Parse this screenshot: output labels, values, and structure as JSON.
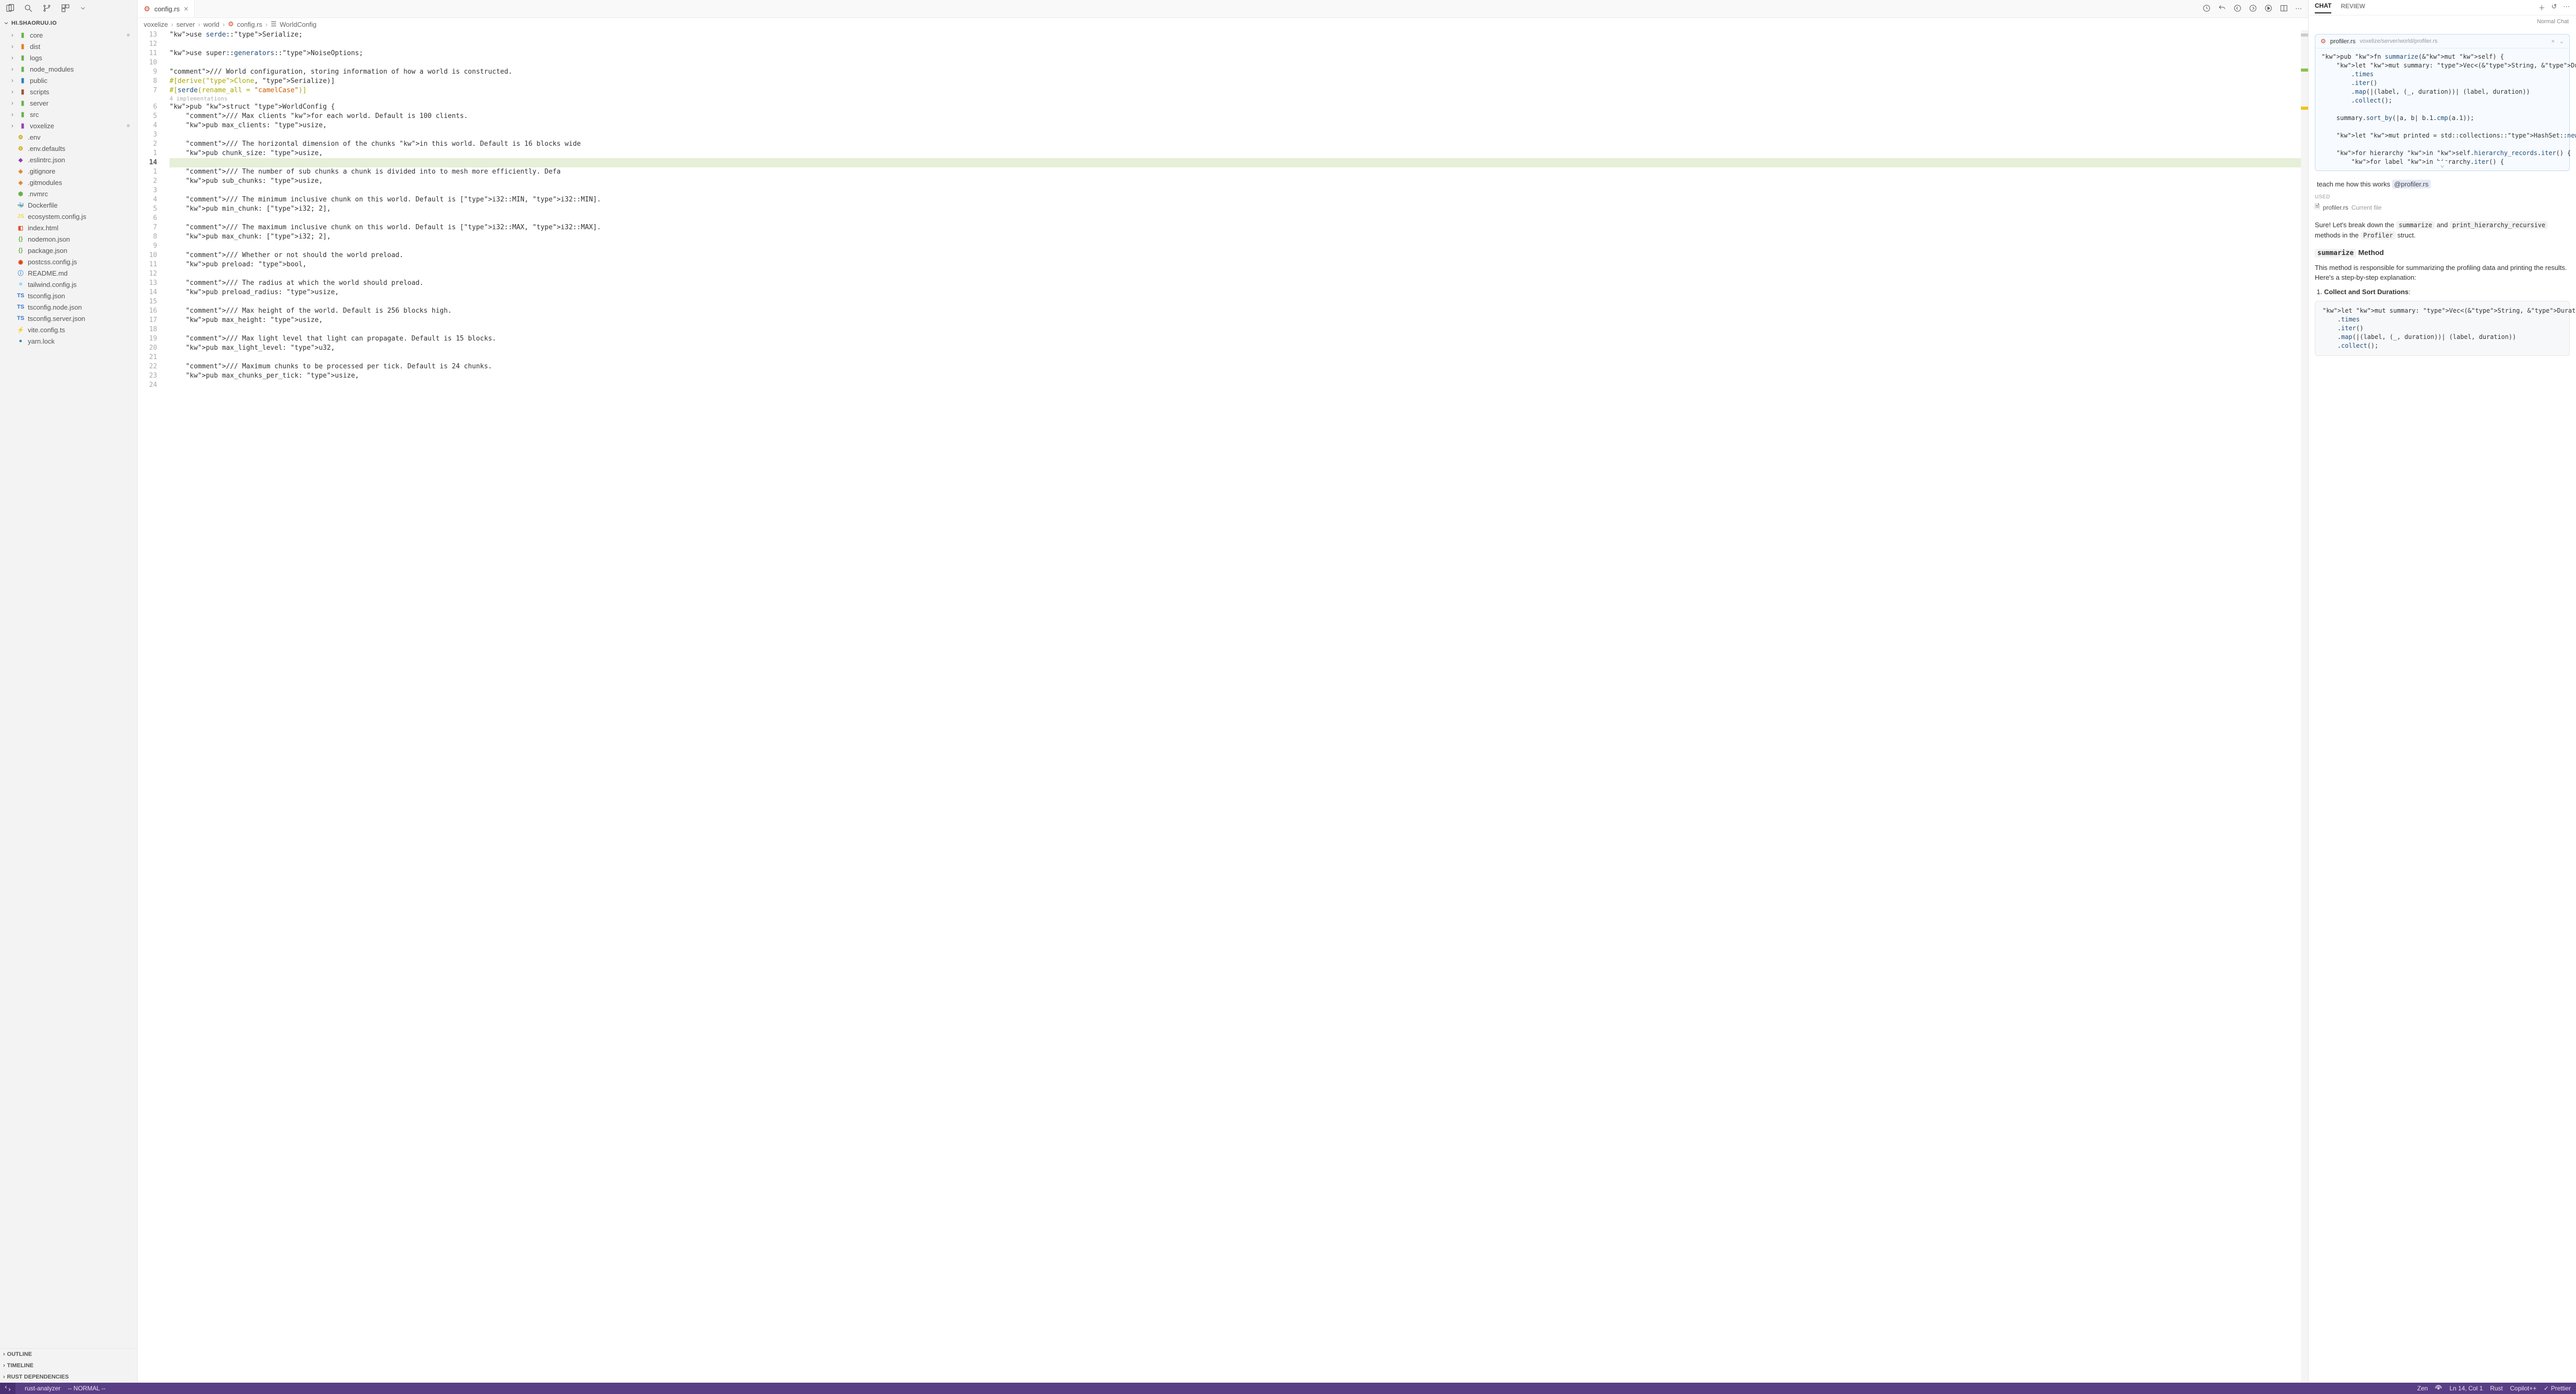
{
  "project": {
    "name": "HI.SHAORUU.IO"
  },
  "sidebar": {
    "folders": [
      {
        "name": "core",
        "color": "folder-green",
        "dot": true
      },
      {
        "name": "dist",
        "color": "folder-orange",
        "dot": false
      },
      {
        "name": "logs",
        "color": "folder-green",
        "dot": false
      },
      {
        "name": "node_modules",
        "color": "folder-green",
        "dot": false
      },
      {
        "name": "public",
        "color": "folder-blue",
        "dot": false
      },
      {
        "name": "scripts",
        "color": "folder-brown",
        "dot": false
      },
      {
        "name": "server",
        "color": "folder-green",
        "dot": false
      },
      {
        "name": "src",
        "color": "folder-green",
        "dot": false
      },
      {
        "name": "voxelize",
        "color": "folder-purple",
        "dot": true
      }
    ],
    "files": [
      {
        "name": ".env",
        "icon": "⚙",
        "iconColor": "#c9a400"
      },
      {
        "name": ".env.defaults",
        "icon": "⚙",
        "iconColor": "#c9a400"
      },
      {
        "name": ".eslintrc.json",
        "icon": "◆",
        "iconColor": "#8e44ad"
      },
      {
        "name": ".gitignore",
        "icon": "◈",
        "iconColor": "#e67e22"
      },
      {
        "name": ".gitmodules",
        "icon": "◈",
        "iconColor": "#e67e22"
      },
      {
        "name": ".nvmrc",
        "icon": "⬢",
        "iconColor": "#6ab04c"
      },
      {
        "name": "Dockerfile",
        "icon": "🐳",
        "iconColor": "#2496ed"
      },
      {
        "name": "ecosystem.config.js",
        "icon": "JS",
        "iconColor": "#f0db4f"
      },
      {
        "name": "index.html",
        "icon": "◧",
        "iconColor": "#e34c26"
      },
      {
        "name": "nodemon.json",
        "icon": "{}",
        "iconColor": "#6ab04c"
      },
      {
        "name": "package.json",
        "icon": "{}",
        "iconColor": "#6ab04c"
      },
      {
        "name": "postcss.config.js",
        "icon": "◉",
        "iconColor": "#dd3a0a"
      },
      {
        "name": "README.md",
        "icon": "ⓘ",
        "iconColor": "#4a90d9"
      },
      {
        "name": "tailwind.config.js",
        "icon": "≈",
        "iconColor": "#38bdf8"
      },
      {
        "name": "tsconfig.json",
        "icon": "TS",
        "iconColor": "#3178c6"
      },
      {
        "name": "tsconfig.node.json",
        "icon": "TS",
        "iconColor": "#3178c6"
      },
      {
        "name": "tsconfig.server.json",
        "icon": "TS",
        "iconColor": "#3178c6"
      },
      {
        "name": "vite.config.ts",
        "icon": "⚡",
        "iconColor": "#ffab00"
      },
      {
        "name": "yarn.lock",
        "icon": "●",
        "iconColor": "#2188b6"
      }
    ],
    "sections": [
      "OUTLINE",
      "TIMELINE",
      "RUST DEPENDENCIES"
    ]
  },
  "tab": {
    "filename": "config.rs"
  },
  "breadcrumb": [
    "voxelize",
    "server",
    "world",
    "config.rs",
    "WorldConfig"
  ],
  "gutter": [
    "13",
    "12",
    "11",
    "10",
    "9",
    "8",
    "7",
    "",
    "6",
    "5",
    "4",
    "3",
    "2",
    "1",
    "14",
    "1",
    "2",
    "3",
    "4",
    "5",
    "6",
    "7",
    "8",
    "9",
    "10",
    "11",
    "12",
    "13",
    "14",
    "15",
    "16",
    "17",
    "18",
    "19",
    "20",
    "21",
    "22",
    "23",
    "24"
  ],
  "code": {
    "l1": "use serde::Serialize;",
    "l2": "",
    "l3": "use super::generators::NoiseOptions;",
    "l4": "",
    "l5": "/// World configuration, storing information of how a world is constructed.",
    "l6": "#[derive(Clone, Serialize)]",
    "l7": "#[serde(rename_all = \"camelCase\")]",
    "codelens": "4 implementations",
    "l8": "pub struct WorldConfig {",
    "l9": "    /// Max clients for each world. Default is 100 clients.",
    "l10": "    pub max_clients: usize,",
    "l11": "",
    "l12": "    /// The horizontal dimension of the chunks in this world. Default is 16 blocks wide",
    "l13": "    pub chunk_size: usize,",
    "l14": "",
    "l15": "    /// The number of sub chunks a chunk is divided into to mesh more efficiently. Defa",
    "l16": "    pub sub_chunks: usize,",
    "l17": "",
    "l18": "    /// The minimum inclusive chunk on this world. Default is [i32::MIN, i32::MIN].",
    "l19": "    pub min_chunk: [i32; 2],",
    "l20": "",
    "l21": "    /// The maximum inclusive chunk on this world. Default is [i32::MAX, i32::MAX].",
    "l22": "    pub max_chunk: [i32; 2],",
    "l23": "",
    "l24": "    /// Whether or not should the world preload.",
    "l25": "    pub preload: bool,",
    "l26": "",
    "l27": "    /// The radius at which the world should preload.",
    "l28": "    pub preload_radius: usize,",
    "l29": "",
    "l30": "    /// Max height of the world. Default is 256 blocks high.",
    "l31": "    pub max_height: usize,",
    "l32": "",
    "l33": "    /// Max light level that light can propagate. Default is 15 blocks.",
    "l34": "    pub max_light_level: u32,",
    "l35": "",
    "l36": "    /// Maximum chunks to be processed per tick. Default is 24 chunks.",
    "l37": "    pub max_chunks_per_tick: usize,",
    "l38": ""
  },
  "chat": {
    "tabs": [
      "CHAT",
      "REVIEW"
    ],
    "mode": "Normal Chat",
    "context": {
      "filename": "profiler.rs",
      "path": "voxelize/server/world/profiler.rs",
      "code": "pub fn summarize(&mut self) {\n    let mut summary: Vec<(&String, &Duration)> = self\n        .times\n        .iter()\n        .map(|(label, (_, duration))| (label, duration))\n        .collect();\n\n    summary.sort_by(|a, b| b.1.cmp(a.1));\n\n    let mut printed = std::collections::HashSet::new();\n\n    for hierarchy in self.hierarchy_records.iter() {\n        for label in hierarchy.iter() {"
    },
    "prompt": {
      "text": "teach me how this works ",
      "mention": "@profiler.rs"
    },
    "used": {
      "label": "USED",
      "item": "profiler.rs",
      "sub": "Current file"
    },
    "response": {
      "intro1": "Sure! Let's break down the ",
      "code1": "summarize",
      "intro2": " and ",
      "code2": "print_hierarchy_recursive",
      "intro3": " methods in the ",
      "code3": "Profiler",
      "intro4": " struct.",
      "h4_code": "summarize",
      "h4_text": " Method",
      "desc": "This method is responsible for summarizing the profiling data and printing the results. Here's a step-by-step explanation:",
      "step1": "Collect and Sort Durations",
      "block": "let mut summary: Vec<(&String, &Duration)> = self\n    .times\n    .iter()\n    .map(|(label, (_, duration))| (label, duration))\n    .collect();"
    }
  },
  "status": {
    "analyzer": "rust-analyzer",
    "vim": "-- NORMAL --",
    "zen": "Zen",
    "pos": "Ln 14, Col 1",
    "lang": "Rust",
    "copilot": "Copilot++",
    "prettier": "Prettier"
  }
}
